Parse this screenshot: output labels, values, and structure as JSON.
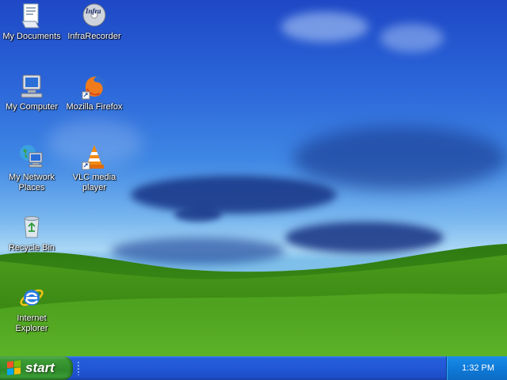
{
  "desktop": {
    "icons": [
      {
        "label": "My Documents",
        "icon": "folder-documents-icon"
      },
      {
        "label": "InfraRecorder",
        "icon": "infrarecorder-icon"
      },
      {
        "label": "My Computer",
        "icon": "computer-icon"
      },
      {
        "label": "Mozilla Firefox",
        "icon": "firefox-icon"
      },
      {
        "label": "My Network Places",
        "icon": "network-places-icon"
      },
      {
        "label": "VLC media player",
        "icon": "vlc-icon"
      },
      {
        "label": "Recycle Bin",
        "icon": "recycle-bin-icon"
      },
      {
        "label": "Internet Explorer",
        "icon": "internet-explorer-icon"
      }
    ],
    "infrarecorder_logo_text": "Infra"
  },
  "taskbar": {
    "start_label": "start",
    "clock": "1:32 PM"
  },
  "colors": {
    "taskbar_blue": "#245edb",
    "start_green": "#3c9c35",
    "tray_blue": "#0f7ad8"
  }
}
